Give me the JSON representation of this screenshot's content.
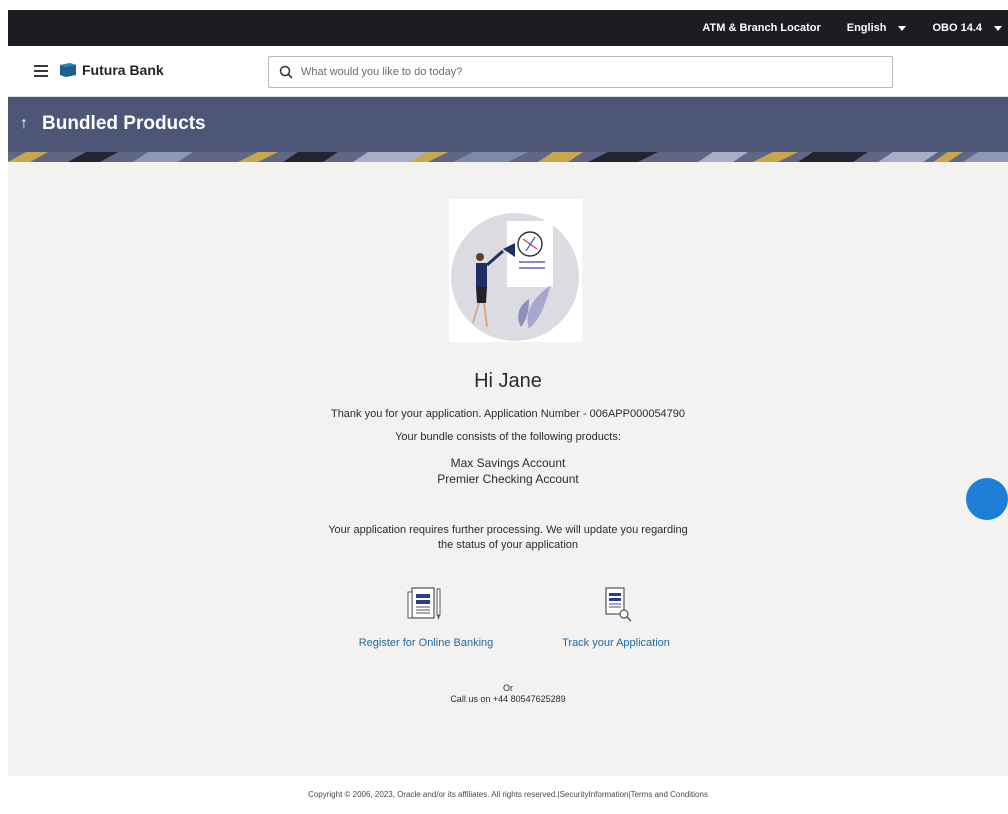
{
  "topbar": {
    "locator": "ATM & Branch Locator",
    "language": "English",
    "version": "OBO 14.4"
  },
  "header": {
    "brand": "Futura Bank",
    "search_placeholder": "What would you like to do today?"
  },
  "banner": {
    "title": "Bundled Products"
  },
  "main": {
    "greeting": "Hi Jane",
    "thanks": "Thank you for your application. Application Number - 006APP000054790",
    "bundle_intro": "Your bundle consists of the following products:",
    "products": [
      "Max Savings Account",
      "Premier Checking Account"
    ],
    "processing_line1": "Your application requires further processing. We will update you regarding",
    "processing_line2": "the status of your application",
    "actions": {
      "register": "Register for Online Banking",
      "track": "Track your Application"
    },
    "or": "Or",
    "call": "Call us on +44 80547625289"
  },
  "footer": {
    "copyright": "Copyright © 2006, 2023, Oracle and/or its affiliates. All rights reserved.|SecurityInformation|Terms and Conditions"
  },
  "colors": {
    "topbar": "#1b1d22",
    "banner": "#4d5677",
    "link": "#1f6aa1",
    "page_bg": "#f3f2f1",
    "fab": "#1e7ed6"
  },
  "icons": [
    "hamburger-icon",
    "bank-logo-icon",
    "search-icon",
    "arrow-up-icon",
    "caret-down-icon",
    "application-form-icon",
    "document-search-icon"
  ]
}
